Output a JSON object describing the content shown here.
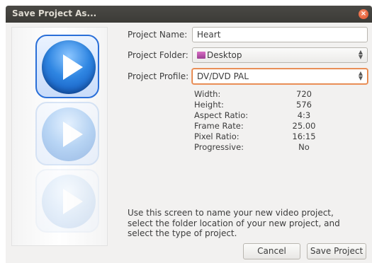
{
  "window": {
    "title": "Save Project As...",
    "close_glyph": "×"
  },
  "form": {
    "name_label": "Project Name:",
    "name_value": "Heart",
    "folder_label": "Project Folder:",
    "folder_value": "Desktop",
    "folder_icon": "folder-icon",
    "profile_label": "Project Profile:",
    "profile_value": "DV/DVD PAL"
  },
  "profile_details": [
    {
      "name": "Width:",
      "value": "720"
    },
    {
      "name": "Height:",
      "value": "576"
    },
    {
      "name": "Aspect Ratio:",
      "value": "4:3"
    },
    {
      "name": "Frame Rate:",
      "value": "25.00"
    },
    {
      "name": "Pixel Ratio:",
      "value": "16:15"
    },
    {
      "name": "Progressive:",
      "value": "No"
    }
  ],
  "help": {
    "line1": "Use this screen to name your new video project,",
    "line2": "select the folder location of your new project, and",
    "line3": "select the type of project."
  },
  "buttons": {
    "cancel": "Cancel",
    "save": "Save Project"
  },
  "wizard_steps": [
    {
      "icon": "play-icon",
      "state": "active"
    },
    {
      "icon": "play-icon",
      "state": "inactive"
    },
    {
      "icon": "play-icon",
      "state": "inactive"
    }
  ],
  "colors": {
    "titlebar": "#3c3b37",
    "close": "#e0522a",
    "focus": "#e07a3a",
    "accent": "#2a6fd8"
  }
}
